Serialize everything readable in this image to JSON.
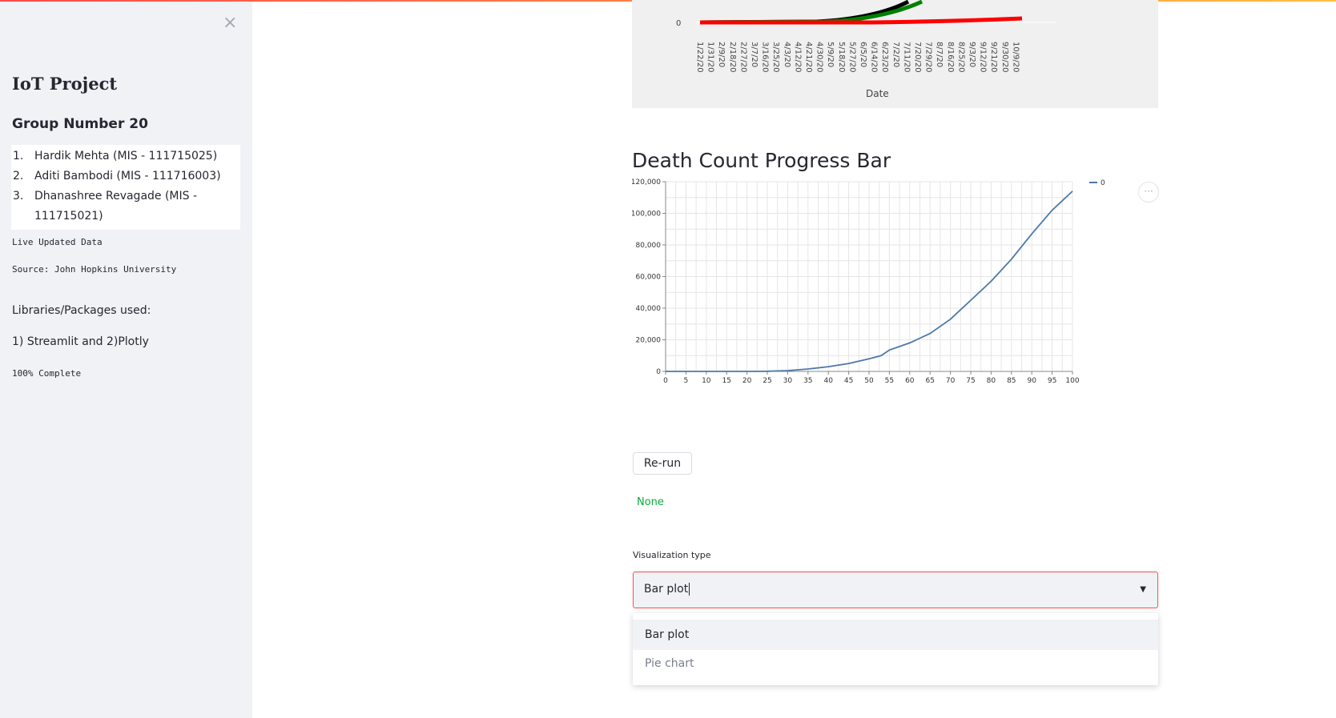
{
  "sidebar": {
    "close_label": "×",
    "title": "IoT Project",
    "group": "Group Number 20",
    "members": [
      {
        "num": "1.",
        "text": "Hardik Mehta (MIS - 111715025)"
      },
      {
        "num": "2.",
        "text": "Aditi Bambodi (MIS - 111716003)"
      },
      {
        "num": "3.",
        "text": "Dhanashree Revagade (MIS - 111715021)"
      }
    ],
    "live": "Live Updated Data",
    "source": "Source: John Hopkins University",
    "libs_heading": "Libraries/Packages used:",
    "libs": "1) Streamlit and 2)Plotly",
    "progress": "100% Complete"
  },
  "chart1": {
    "xlabel": "Date",
    "y_tick": "0",
    "dates": [
      "1/22/20",
      "1/31/20",
      "2/9/20",
      "2/18/20",
      "2/27/20",
      "3/7/20",
      "3/16/20",
      "3/25/20",
      "4/3/20",
      "4/12/20",
      "4/21/20",
      "4/30/20",
      "5/9/20",
      "5/18/20",
      "5/27/20",
      "6/5/20",
      "6/14/20",
      "6/23/20",
      "7/2/20",
      "7/11/20",
      "7/20/20",
      "7/29/20",
      "8/7/20",
      "8/16/20",
      "8/25/20",
      "9/3/20",
      "9/12/20",
      "9/21/20",
      "9/30/20",
      "10/9/20"
    ],
    "colors": {
      "black": "#000000",
      "green": "#008000",
      "red": "#ff0000"
    }
  },
  "death_title": "Death Count Progress Bar",
  "chart_data": {
    "type": "line",
    "title": "",
    "xlabel": "",
    "ylabel": "",
    "xlim": [
      0,
      100
    ],
    "ylim": [
      0,
      120000
    ],
    "x_ticks": [
      "0",
      "5",
      "10",
      "15",
      "20",
      "25",
      "30",
      "35",
      "40",
      "45",
      "50",
      "55",
      "60",
      "65",
      "70",
      "75",
      "80",
      "85",
      "90",
      "95",
      "100"
    ],
    "y_ticks": [
      "0",
      "20,000",
      "40,000",
      "60,000",
      "80,000",
      "100,000",
      "120,000"
    ],
    "grid": true,
    "legend": "top-right",
    "series": [
      {
        "name": "0",
        "color": "#4c78a8",
        "x": [
          0,
          5,
          10,
          15,
          20,
          25,
          30,
          35,
          40,
          45,
          50,
          53,
          55,
          60,
          65,
          70,
          75,
          80,
          85,
          90,
          95,
          100
        ],
        "values": [
          0,
          0,
          0,
          0,
          0,
          100,
          500,
          1500,
          3000,
          5000,
          8000,
          10000,
          13500,
          18000,
          24000,
          33000,
          45000,
          57000,
          71000,
          87000,
          102000,
          114000
        ]
      }
    ]
  },
  "modebar_label": "···",
  "rerun_label": "Re-run",
  "none_text": "None",
  "select": {
    "label": "Visualization type",
    "value": "Bar plot",
    "options": [
      "Bar plot",
      "Pie chart"
    ]
  }
}
